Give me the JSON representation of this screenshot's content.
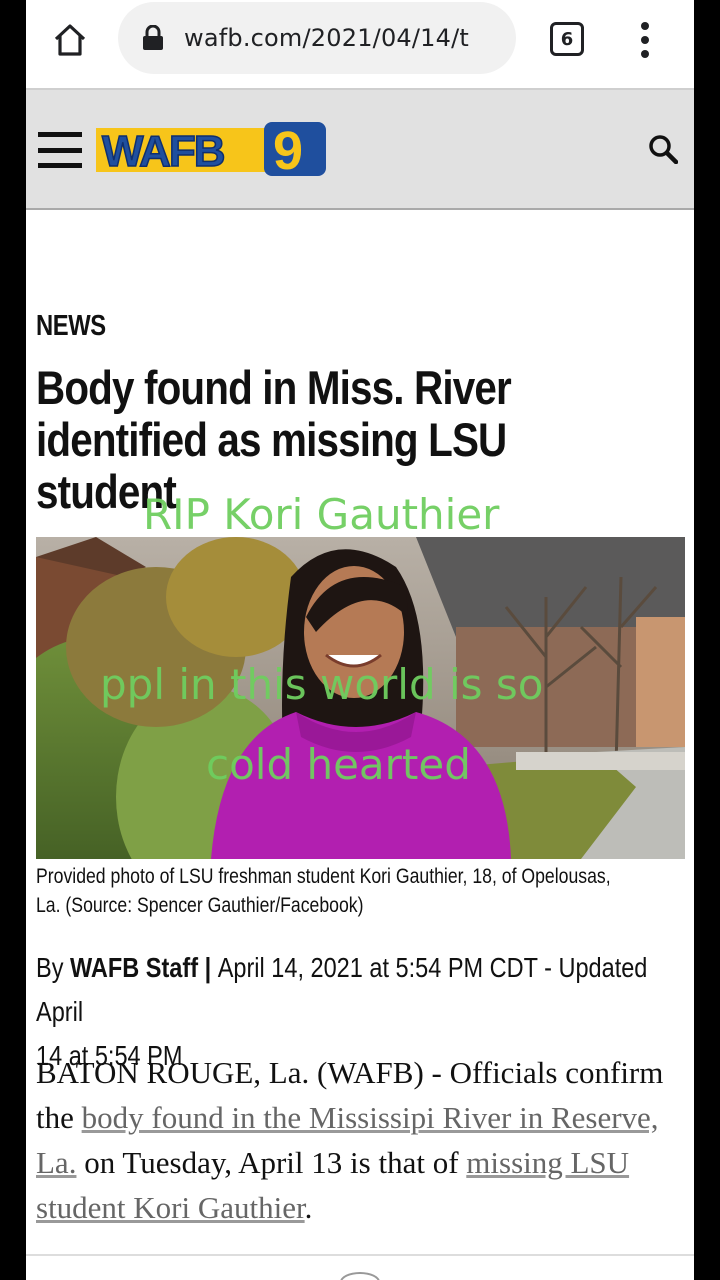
{
  "browser": {
    "url": "wafb.com/2021/04/14/t",
    "tab_count": "6",
    "icons": {
      "home": "home-icon",
      "lock": "lock-icon",
      "menu": "more-vert-icon"
    }
  },
  "site": {
    "logo_text": "WAFB",
    "logo_number": "9",
    "colors": {
      "logo_blue": "#1f4f9e",
      "logo_yellow": "#f7c51a",
      "header_bg": "#e1e1e1"
    }
  },
  "article": {
    "section": "NEWS",
    "headline_lines": [
      "Body found in Miss. River",
      "identified as missing LSU",
      "student"
    ],
    "caption_lines": [
      "Provided photo of LSU freshman student Kori Gauthier, 18, of Opelousas,",
      "La. (Source: Spencer Gauthier/Facebook)"
    ],
    "byline": {
      "prefix": "By ",
      "author": "WAFB Staff",
      "separator": " | ",
      "date_line1": "April 14, 2021 at 5:54 PM CDT - Updated April",
      "date_line2": "14 at 5:54 PM"
    },
    "body": {
      "text1": "BATON ROUGE, La. (WAFB) - Officials confirm the ",
      "link1": "body found in the Mississipi River in Reserve, La.",
      "text2": " on Tuesday, April 13 is that of ",
      "link2": "missing LSU student Kori Gauthier",
      "text3": "."
    }
  },
  "overlay": {
    "line1": "RIP Kori Gauthier",
    "line2": "ppl in this world is so",
    "line3": "cold hearted",
    "color": "#6fce5f"
  }
}
